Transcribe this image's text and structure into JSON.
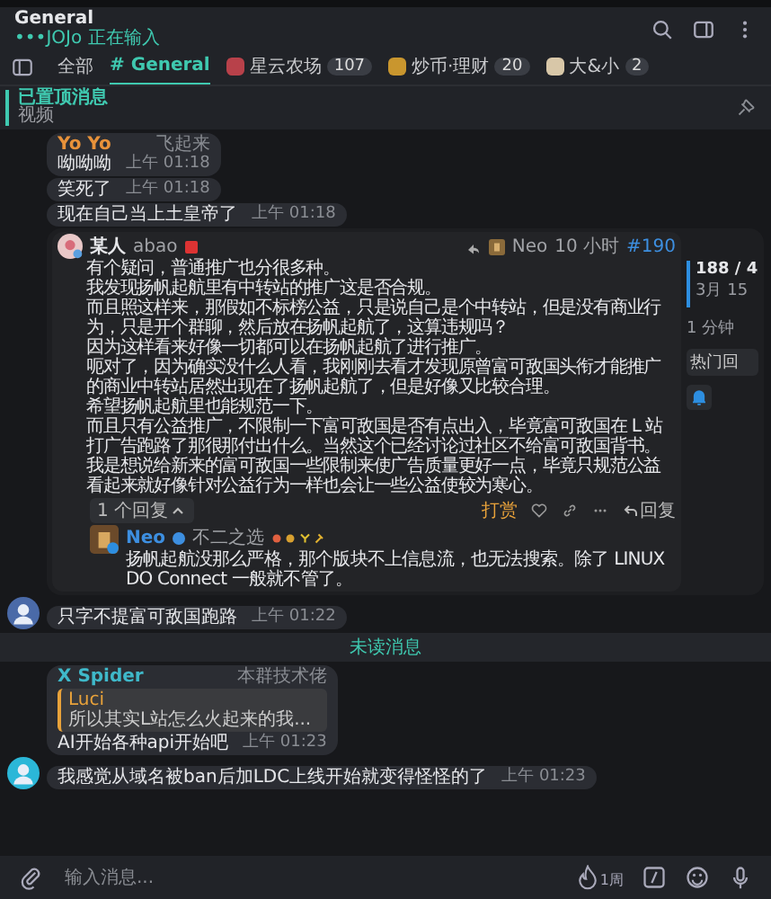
{
  "header": {
    "title": "General",
    "typing": "•••JOJo 正在输入"
  },
  "tabs": [
    {
      "label": "全部",
      "selected": false
    },
    {
      "label": "# General",
      "selected": true
    },
    {
      "label": "星云农场",
      "badge": "107",
      "selected": false
    },
    {
      "label": "炒币·理财",
      "badge": "20",
      "selected": false
    },
    {
      "label": "大&小",
      "badge": "2",
      "selected": false
    }
  ],
  "pinned": {
    "label": "已置顶消息",
    "text": "视频"
  },
  "messages": [
    {
      "kind": "text",
      "sender": "Yo Yo",
      "tag": "飞起来",
      "text": "呦呦呦",
      "time": "上午 01:18",
      "avatar": false
    },
    {
      "kind": "text",
      "text": "笑死了",
      "time": "上午 01:18",
      "avatar": false
    },
    {
      "kind": "text",
      "text": "现在自己当上土皇帝了",
      "time": "上午 01:18",
      "avatar": false
    },
    {
      "kind": "post",
      "avatar": false,
      "post": {
        "author": "某人",
        "username": "abao",
        "reply_to": "Neo",
        "age": "10 小时",
        "number": "#190",
        "paragraphs": [
          "有个疑问，普通推广也分很多种。",
          "我发现扬帆起航里有中转站的推广这是否合规。",
          "而且照这样来，那假如不标榜公益，只是说自己是个中转站，但是没有商业行为，只是开个群聊，然后放在扬帆起航了，这算违规吗？",
          "因为这样看来好像一切都可以在扬帆起航了进行推广。",
          "呃对了，因为确实没什么人看，我刚刚去看才发现原曾富可敌国头衔才能推广的商业中转站居然出现在了扬帆起航了，但是好像又比较合理。",
          "希望扬帆起航里也能规范一下。",
          "而且只有公益推广，不限制一下富可敌国是否有点出入，毕竟富可敌国在 L 站打广告跑路了那很那付出什么。当然这个已经讨论过社区不给富可敌国背书。",
          "我是想说给新来的富可敌国一些限制来使广告质量更好一点，毕竟只规范公益看起来就好像针对公益行为一样也会让一些公益使较为寒心。"
        ],
        "timeline": {
          "position": "188 / 4",
          "date": "3月 15",
          "ago": "1 分钟",
          "hot": "热门回"
        },
        "replies": "1 个回复",
        "tip": "打赏",
        "reply": "回复",
        "reply_post": {
          "author": "Neo",
          "title": "不二之选",
          "text": "扬帆起航没那么严格，那个版块不上信息流，也无法搜索。除了 LINUX DO Connect 一般就不管了。"
        }
      }
    },
    {
      "kind": "text",
      "text": "只字不提富可敌国跑路",
      "time": "上午 01:22",
      "avatar": true
    },
    {
      "kind": "divider",
      "text": "未读消息"
    },
    {
      "kind": "text",
      "sender": "X Spider",
      "tag": "本群技术佬",
      "quote": {
        "author": "Luci",
        "text": "所以其实L站怎么火起来的我..."
      },
      "text": "AI开始各种api开始吧",
      "time": "上午 01:23",
      "avatar": false
    },
    {
      "kind": "text",
      "text": "我感觉从域名被ban后加LDC上线开始就变得怪怪的了",
      "time": "上午 01:23",
      "avatar": true
    }
  ],
  "input": {
    "placeholder": "输入消息...",
    "timer": "1周"
  }
}
